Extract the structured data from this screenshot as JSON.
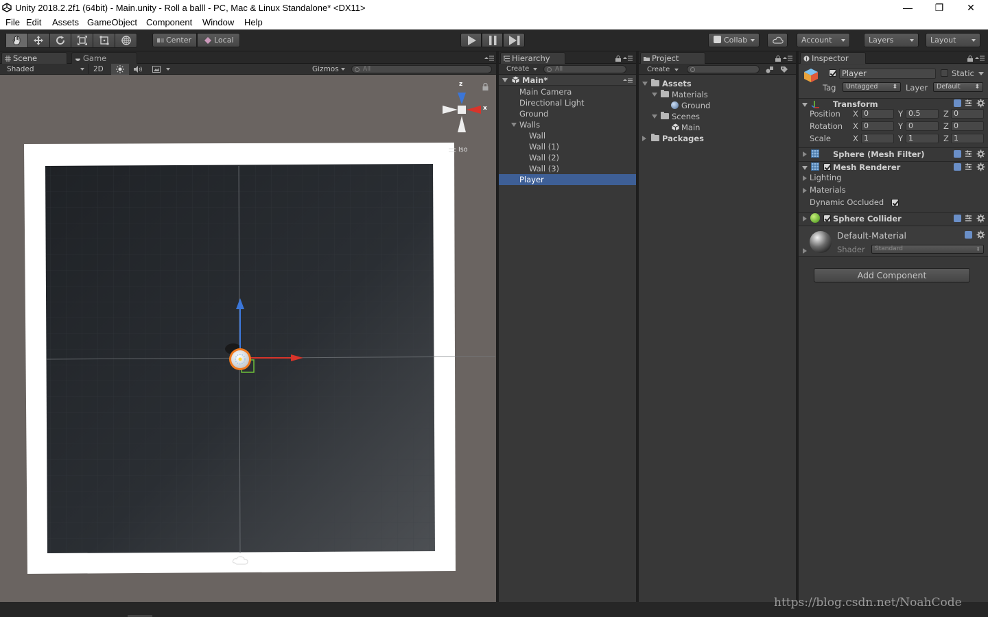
{
  "window": {
    "title": "Unity 2018.2.2f1 (64bit) - Main.unity - Roll a balll - PC, Mac & Linux Standalone* <DX11>",
    "minimize": "—",
    "restore": "❐",
    "close": "✕"
  },
  "menu": [
    "File",
    "Edit",
    "Assets",
    "GameObject",
    "Component",
    "Window",
    "Help"
  ],
  "toolbar": {
    "pivot": "Center",
    "space": "Local",
    "collab": "Collab",
    "account": "Account",
    "layers": "Layers",
    "layout": "Layout"
  },
  "scene_panel": {
    "tabs": [
      "Scene",
      "Game"
    ],
    "shading": "Shaded",
    "mode_2d": "2D",
    "gizmos": "Gizmos",
    "search_placeholder": "All",
    "gizmo_z": "z",
    "gizmo_x": "x",
    "projection": "Iso"
  },
  "hierarchy": {
    "tab": "Hierarchy",
    "create": "Create",
    "search_placeholder": "All",
    "scene": "Main*",
    "items": [
      "Main Camera",
      "Directional Light",
      "Ground",
      "Walls",
      "Wall",
      "Wall (1)",
      "Wall (2)",
      "Wall (3)",
      "Player"
    ],
    "selected": "Player"
  },
  "project": {
    "tab": "Project",
    "create": "Create",
    "tree": [
      "Assets",
      "Materials",
      "Ground",
      "Scenes",
      "Main",
      "Packages"
    ]
  },
  "inspector": {
    "tab": "Inspector",
    "object_name": "Player",
    "active": true,
    "static_label": "Static",
    "tag_label": "Tag",
    "tag_value": "Untagged",
    "layer_label": "Layer",
    "layer_value": "Default",
    "transform": {
      "title": "Transform",
      "position_label": "Position",
      "rotation_label": "Rotation",
      "scale_label": "Scale",
      "axis": [
        "X",
        "Y",
        "Z"
      ],
      "position": [
        "0",
        "0.5",
        "0"
      ],
      "rotation": [
        "0",
        "0",
        "0"
      ],
      "scale": [
        "1",
        "1",
        "1"
      ]
    },
    "mesh_filter": "Sphere (Mesh Filter)",
    "mesh_renderer": {
      "title": "Mesh Renderer",
      "lighting": "Lighting",
      "materials": "Materials",
      "dynamic_occluded": "Dynamic Occluded"
    },
    "sphere_collider": "Sphere Collider",
    "material": {
      "name": "Default-Material",
      "shader_label": "Shader",
      "shader_value": "Standard"
    },
    "add_component": "Add Component"
  },
  "watermark": "https://blog.csdn.net/NoahCode"
}
